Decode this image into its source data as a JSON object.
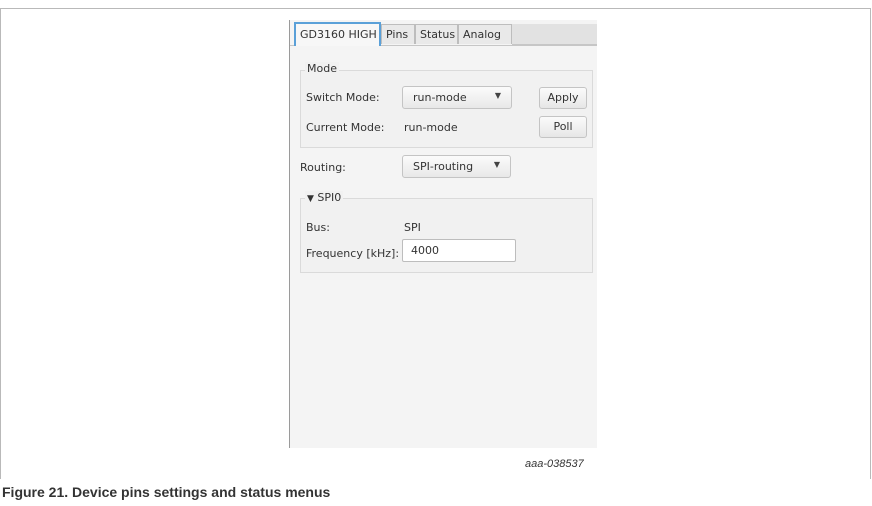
{
  "tabs": [
    {
      "label": "GD3160 HIGH",
      "active": true
    },
    {
      "label": "Pins",
      "active": false
    },
    {
      "label": "Status",
      "active": false
    },
    {
      "label": "Analog",
      "active": false
    }
  ],
  "mode": {
    "legend": "Mode",
    "switch_mode_label": "Switch Mode:",
    "switch_mode_value": "run-mode",
    "apply_label": "Apply",
    "current_mode_label": "Current Mode:",
    "current_mode_value": "run-mode",
    "poll_label": "Poll"
  },
  "routing": {
    "label": "Routing:",
    "value": "SPI-routing"
  },
  "spi": {
    "legend": "SPI0",
    "bus_label": "Bus:",
    "bus_value": "SPI",
    "frequency_label": "Frequency [kHz]:",
    "frequency_value": "4000"
  },
  "figure": {
    "watermark": "aaa-038537",
    "caption": "Figure 21.  Device pins settings and status menus"
  },
  "colors": {
    "active_tab_border": "#5aa0d8",
    "panel_background": "#f4f4f4"
  }
}
